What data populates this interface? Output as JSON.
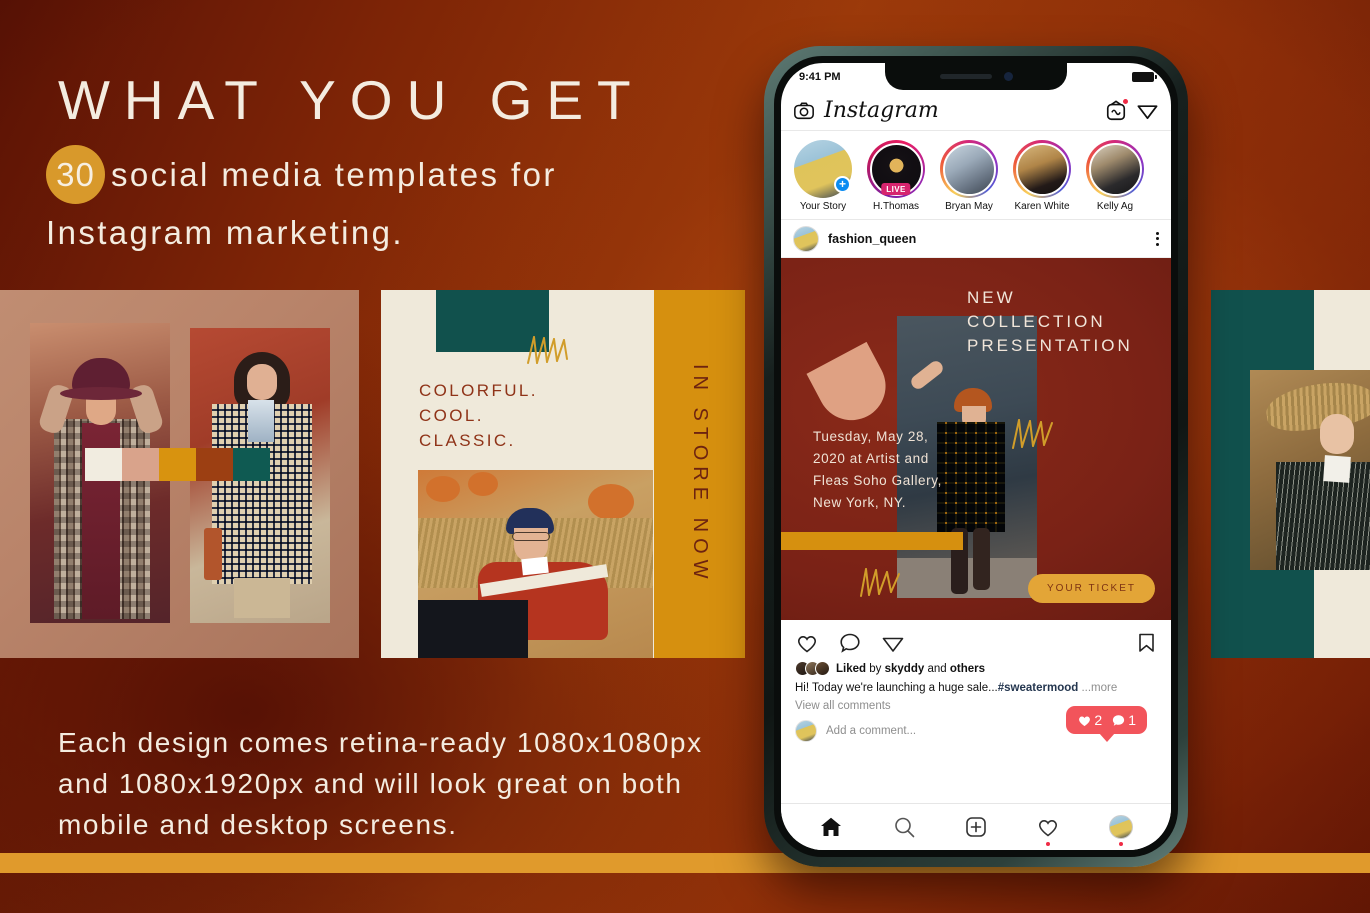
{
  "promo": {
    "headline": "WHAT YOU GET",
    "count_badge": "30",
    "sub_line1_rest": "social media templates for",
    "sub_line2": "Instagram marketing.",
    "paragraph": "Each design comes retina-ready 1080x1080px and 1080x1920px and will look great on both mobile and desktop screens.",
    "accent_gold": "#d8992b",
    "accent_cream": "#f4ece0",
    "bg_rust": "#8a2a07"
  },
  "cards": {
    "card1": {
      "name": "lookbook-swatches-template",
      "swatches": [
        "#f1ece0",
        "#d9a38b",
        "#d8930f",
        "#9c3f12",
        "#0f5a52"
      ]
    },
    "card2": {
      "name": "colorful-cool-classic-template",
      "lines": [
        "COLORFUL.",
        "COOL.",
        "CLASSIC."
      ],
      "vertical_label": "IN STORE NOW",
      "teal": "#11514d",
      "gold": "#d6900f",
      "cream": "#efe9da",
      "text_color": "#8f3318"
    },
    "card3": {
      "name": "teal-portrait-template",
      "teal": "#11514d",
      "cream": "#efe9da"
    }
  },
  "phone": {
    "status": {
      "time": "9:41 PM"
    },
    "ig_header": {
      "logo_text": "Instagram",
      "camera_icon": "camera-icon",
      "igtv_icon": "igtv-icon",
      "send_icon": "send-icon"
    },
    "stories": [
      {
        "label": "Your Story",
        "type": "own",
        "plus": "+"
      },
      {
        "label": "H.Thomas",
        "type": "live",
        "live_label": "LIVE"
      },
      {
        "label": "Bryan May",
        "type": "story"
      },
      {
        "label": "Karen White",
        "type": "story"
      },
      {
        "label": "Kelly Ag",
        "type": "story"
      }
    ],
    "post": {
      "username": "fashion_queen",
      "title_lines": [
        "NEW",
        "COLLECTION",
        "PRESENTATION"
      ],
      "info_lines": [
        "Tuesday, May 28,",
        "2020 at Artist and",
        "Fleas Soho Gallery,",
        "New York, NY."
      ],
      "ticket_label": "YOUR TICKET",
      "bg_color": "#7e2418",
      "gold": "#d6900f"
    },
    "engagement": {
      "liked_prefix": "Liked",
      "liked_by": "by",
      "liked_user": "skyddy",
      "liked_and": "and",
      "liked_others": "others",
      "caption": "Hi! Today we're launching a huge sale...",
      "hashtag": "#sweatermood",
      "more": " ...more",
      "view_comments": "View all comments",
      "add_comment_placeholder": "Add a comment...",
      "notif_likes": "2",
      "notif_comments": "1",
      "notif_color": "#f2545b"
    },
    "tabbar": [
      {
        "name": "home-icon"
      },
      {
        "name": "search-icon"
      },
      {
        "name": "add-post-icon"
      },
      {
        "name": "heart-activity-icon"
      },
      {
        "name": "profile-avatar"
      }
    ]
  }
}
